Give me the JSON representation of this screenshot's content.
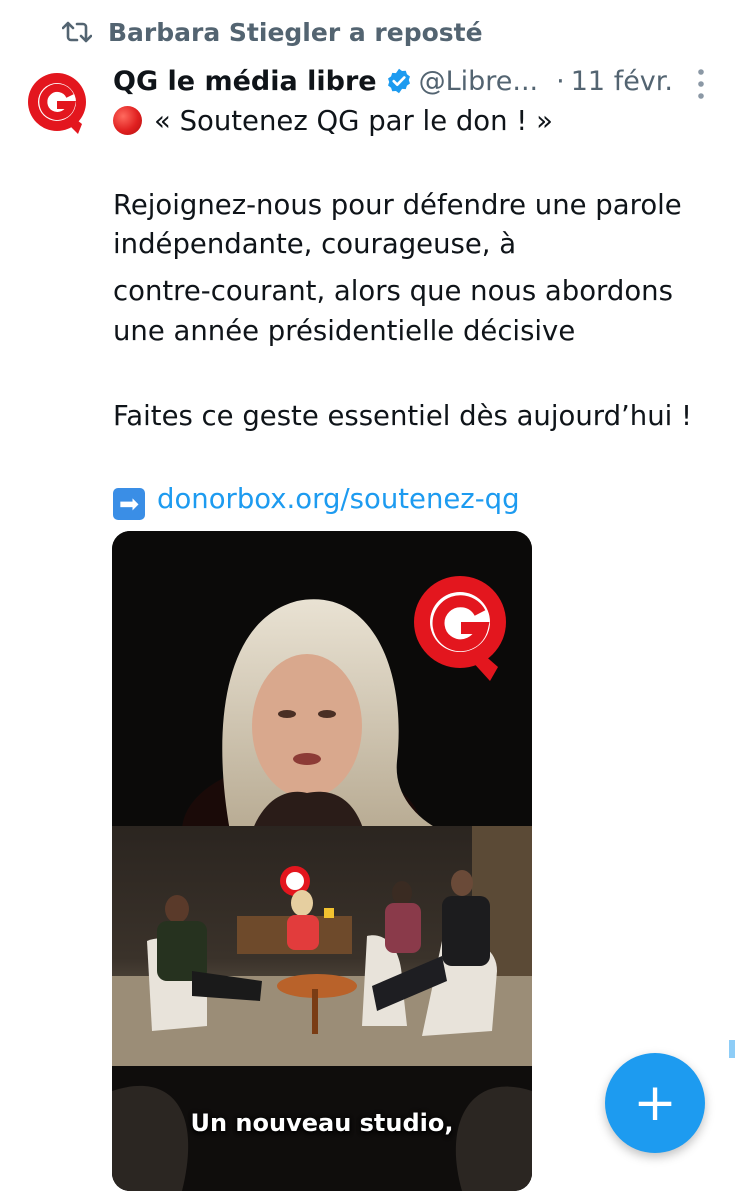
{
  "repost": {
    "label": "Barbara Stiegler a reposté",
    "icon": "repost-icon"
  },
  "tweet": {
    "display_name": "QG le média libre",
    "verified": true,
    "handle": "@Libre...",
    "separator": "·",
    "date": "11 févr.",
    "lines": [
      "« Soutenez QG par le don ! »",
      "Rejoignez-nous pour défendre une parole",
      "indépendante, courageuse, à",
      "contre-courant, alors que nous abordons",
      "une année présidentielle décisive",
      "Faites ce geste essentiel dès aujourd’hui !"
    ],
    "link_text": "donorbox.org/soutenez-qg",
    "arrow_emoji": "➡",
    "media_caption": "Un nouveau studio,"
  },
  "fab": {
    "label": "+",
    "icon": "compose-plus-icon"
  },
  "colors": {
    "accent": "#1d9bf0",
    "muted_text": "#536471",
    "brand_red": "#e3161e"
  }
}
